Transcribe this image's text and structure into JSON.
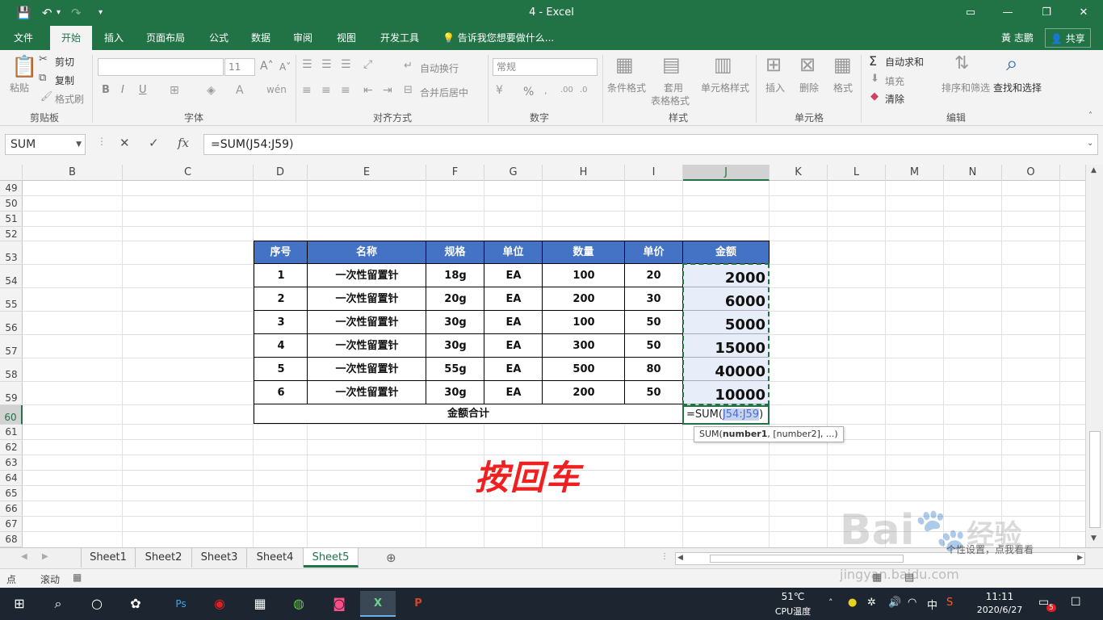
{
  "titlebar": {
    "title": "4  -  Excel",
    "save_icon": "save-icon",
    "undo_icon": "undo-icon",
    "redo_icon": "redo-icon",
    "customize_icon": "dropdown-icon"
  },
  "window_controls": {
    "restore_ribbon": "▭",
    "minimize": "—",
    "maximize": "❐",
    "close": "✕"
  },
  "tabs": [
    "文件",
    "开始",
    "插入",
    "页面布局",
    "公式",
    "数据",
    "审阅",
    "视图",
    "开发工具"
  ],
  "active_tab": "开始",
  "tell_me": "告诉我您想要做什么...",
  "user_name": "黃 志鹏",
  "share_label": "共享",
  "ribbon": {
    "clipboard": {
      "label": "剪贴板",
      "paste": "粘贴",
      "cut": "剪切",
      "copy": "复制",
      "format_painter": "格式刷"
    },
    "font": {
      "label": "字体",
      "font_name": "",
      "font_size": "11",
      "bold": "B",
      "italic": "I",
      "underline": "U"
    },
    "alignment": {
      "label": "对齐方式",
      "wrap_text": "自动换行",
      "merge_center": "合并后居中"
    },
    "number": {
      "label": "数字",
      "format": "常规",
      "percent": "%"
    },
    "styles": {
      "label": "样式",
      "conditional": "条件格式",
      "table_format_1": "套用",
      "table_format_2": "表格格式",
      "cell_styles": "单元格样式"
    },
    "cells": {
      "label": "单元格",
      "insert": "插入",
      "delete": "删除",
      "format": "格式"
    },
    "editing": {
      "label": "编辑",
      "autosum": "自动求和",
      "fill": "填充",
      "clear": "清除",
      "sort_filter": "排序和筛选",
      "find_select": "查找和选择"
    }
  },
  "formula_bar": {
    "name_box": "SUM",
    "cancel": "✕",
    "enter": "✓",
    "fx": "fx",
    "formula": "=SUM(J54:J59)"
  },
  "columns": [
    "B",
    "C",
    "D",
    "E",
    "F",
    "G",
    "H",
    "I",
    "J",
    "K",
    "L",
    "M",
    "N",
    "O"
  ],
  "selected_column": "J",
  "rows": [
    "49",
    "50",
    "51",
    "52",
    "53",
    "54",
    "55",
    "56",
    "57",
    "58",
    "59",
    "60",
    "61",
    "62",
    "63",
    "64",
    "65",
    "66",
    "67",
    "68"
  ],
  "selected_row": "60",
  "table": {
    "headers": [
      "序号",
      "名称",
      "规格",
      "单位",
      "数量",
      "单价",
      "金额"
    ],
    "rows": [
      [
        "1",
        "一次性留置针",
        "18g",
        "EA",
        "100",
        "20",
        "2000"
      ],
      [
        "2",
        "一次性留置针",
        "20g",
        "EA",
        "200",
        "30",
        "6000"
      ],
      [
        "3",
        "一次性留置针",
        "30g",
        "EA",
        "100",
        "50",
        "5000"
      ],
      [
        "4",
        "一次性留置针",
        "30g",
        "EA",
        "300",
        "50",
        "15000"
      ],
      [
        "5",
        "一次性留置针",
        "55g",
        "EA",
        "500",
        "80",
        "40000"
      ],
      [
        "6",
        "一次性留置针",
        "30g",
        "EA",
        "200",
        "50",
        "10000"
      ]
    ],
    "total_label": "金额合计",
    "edit_prefix": "=SUM(",
    "edit_ref": "J54:J59",
    "edit_suffix": ")"
  },
  "tooltip": {
    "fn": "SUM(",
    "arg1": "number1",
    "rest": ", [number2], ...)"
  },
  "annotation": "按回车",
  "sheets": [
    "Sheet1",
    "Sheet2",
    "Sheet3",
    "Sheet4",
    "Sheet5"
  ],
  "active_sheet": "Sheet5",
  "statusbar": {
    "mode": "点",
    "scroll": "滚动"
  },
  "taskbar": {
    "weather": "51℃",
    "weather_sub": "CPU温度",
    "ime": "中",
    "time": "11:11",
    "date": "2020/6/27",
    "notif_count": "5"
  },
  "watermark": "Bai",
  "watermark_suffix": "经验",
  "watermark_url": "jingyan.baidu.com",
  "watermark_overlay": "个性设置，点我看看"
}
